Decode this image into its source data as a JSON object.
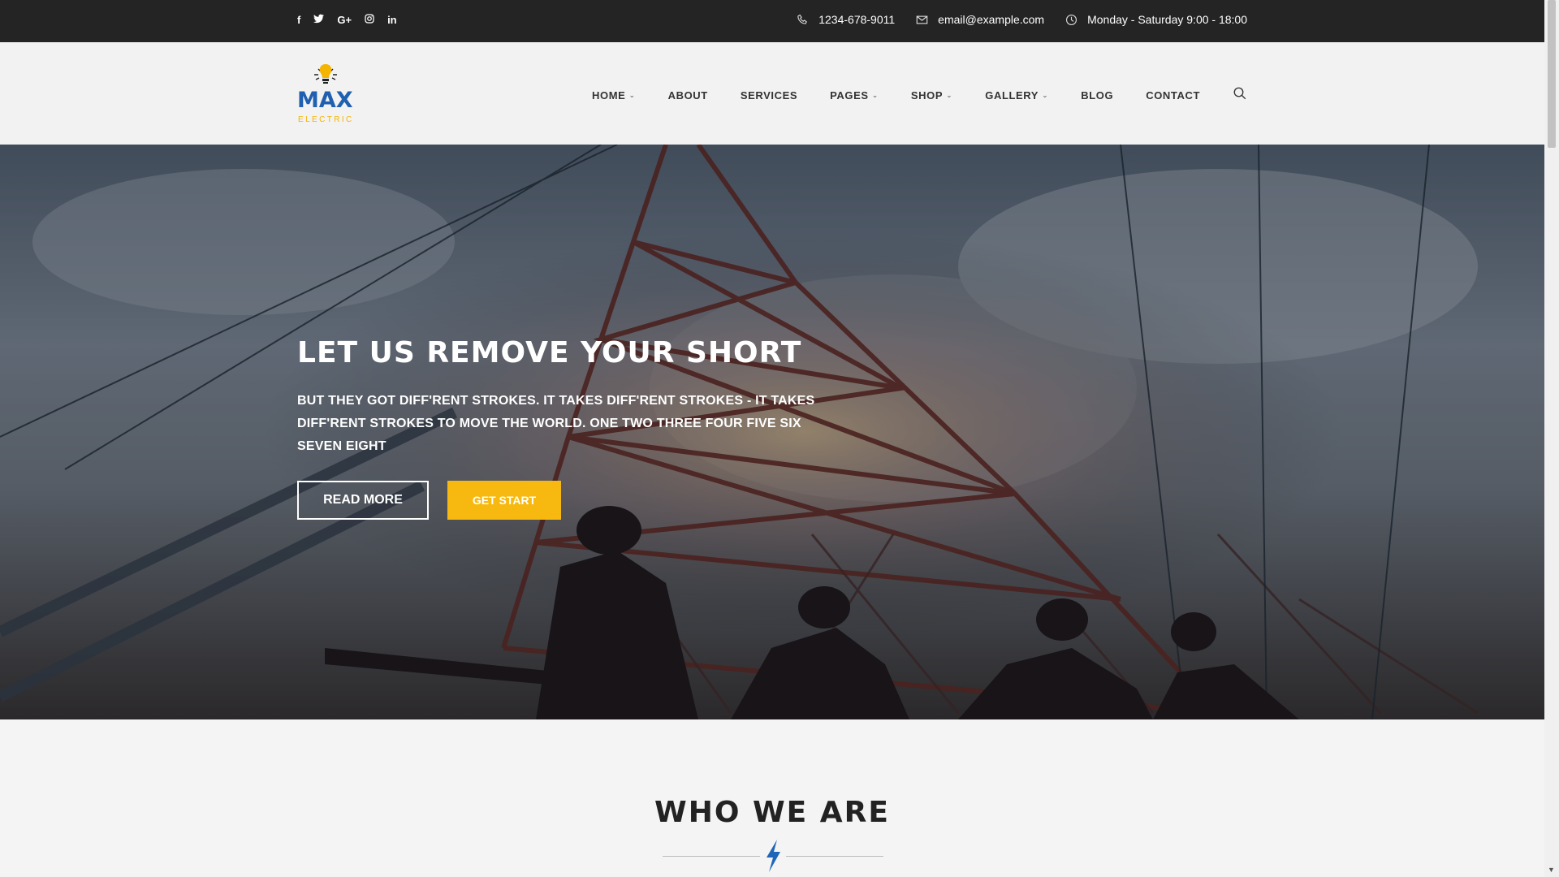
{
  "topbar": {
    "social": [
      {
        "icon": "facebook-icon",
        "glyph": "f"
      },
      {
        "icon": "twitter-icon",
        "glyph": "🐦"
      },
      {
        "icon": "google-plus-icon",
        "glyph": "G+"
      },
      {
        "icon": "instagram-icon",
        "glyph": "◎"
      },
      {
        "icon": "linkedin-icon",
        "glyph": "in"
      }
    ],
    "phone": "1234-678-9011",
    "email": "email@example.com",
    "hours": "Monday - Saturday 9:00 - 18:00"
  },
  "header": {
    "logo": {
      "name": "MAX",
      "tagline": "ELECTRIC"
    },
    "nav": [
      {
        "label": "HOME",
        "dropdown": true
      },
      {
        "label": "ABOUT",
        "dropdown": false
      },
      {
        "label": "SERVICES",
        "dropdown": false
      },
      {
        "label": "PAGES",
        "dropdown": true
      },
      {
        "label": "SHOP",
        "dropdown": true
      },
      {
        "label": "GALLERY",
        "dropdown": true
      },
      {
        "label": "BLOG",
        "dropdown": false
      },
      {
        "label": "CONTACT",
        "dropdown": false
      }
    ]
  },
  "hero": {
    "title": "LET US REMOVE YOUR SHORT",
    "text": "BUT THEY GOT DIFF'RENT STROKES. IT TAKES DIFF'RENT STROKES - IT TAKES DIFF'RENT STROKES TO MOVE THE WORLD. ONE TWO THREE FOUR FIVE SIX SEVEN EIGHT",
    "read_more": "READ MORE",
    "get_start": "GET START"
  },
  "who_we_are": {
    "title": "WHO WE ARE"
  },
  "colors": {
    "accent": "#f7b90f",
    "brand_blue": "#2060b0",
    "topbar": "#242424"
  }
}
